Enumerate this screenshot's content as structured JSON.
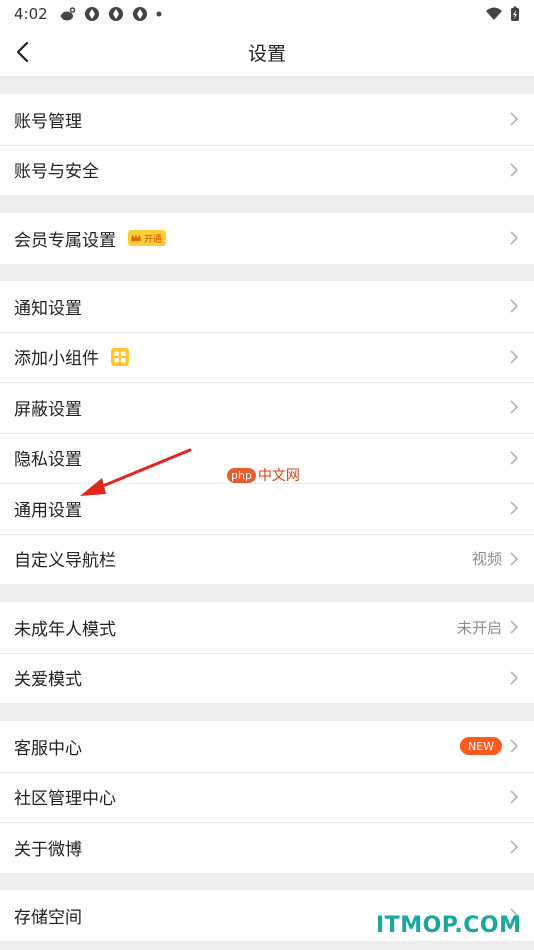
{
  "status": {
    "time": "4:02"
  },
  "nav": {
    "title": "设置"
  },
  "groups": [
    {
      "items": [
        {
          "label": "账号管理"
        },
        {
          "label": "账号与安全"
        }
      ]
    },
    {
      "items": [
        {
          "label": "会员专属设置",
          "badge": "开通"
        }
      ]
    },
    {
      "items": [
        {
          "label": "通知设置"
        },
        {
          "label": "添加小组件"
        },
        {
          "label": "屏蔽设置"
        },
        {
          "label": "隐私设置"
        },
        {
          "label": "通用设置"
        },
        {
          "label": "自定义导航栏",
          "value": "视频"
        }
      ]
    },
    {
      "items": [
        {
          "label": "未成年人模式",
          "value": "未开启"
        },
        {
          "label": "关爱模式"
        }
      ]
    },
    {
      "items": [
        {
          "label": "客服中心",
          "badge": "NEW"
        },
        {
          "label": "社区管理中心"
        },
        {
          "label": "关于微博"
        }
      ]
    },
    {
      "items": [
        {
          "label": "存储空间"
        }
      ]
    }
  ],
  "watermarks": {
    "php_logo": "php",
    "php_text": "中文网",
    "site": "ITMOP.COM"
  },
  "colors": {
    "accent_orange": "#ff5a1f",
    "vip_gold": "#ffcf3a",
    "annotation_arrow": "#e0281e",
    "watermark_teal": "#1aa7a0"
  }
}
